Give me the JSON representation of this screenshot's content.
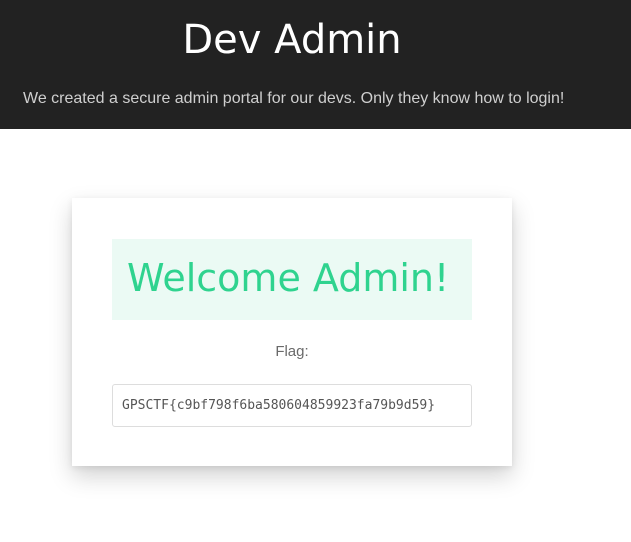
{
  "header": {
    "title": "Dev Admin",
    "subtitle": "We created a secure admin portal for our devs. Only they know how to login!"
  },
  "card": {
    "welcome": "Welcome Admin!",
    "flag_label": "Flag:",
    "flag_value": "GPSCTF{c9bf798f6ba580604859923fa79b9d59}"
  },
  "colors": {
    "header_bg": "#222222",
    "accent": "#2fd38f",
    "welcome_bg": "#ebfaf4"
  }
}
